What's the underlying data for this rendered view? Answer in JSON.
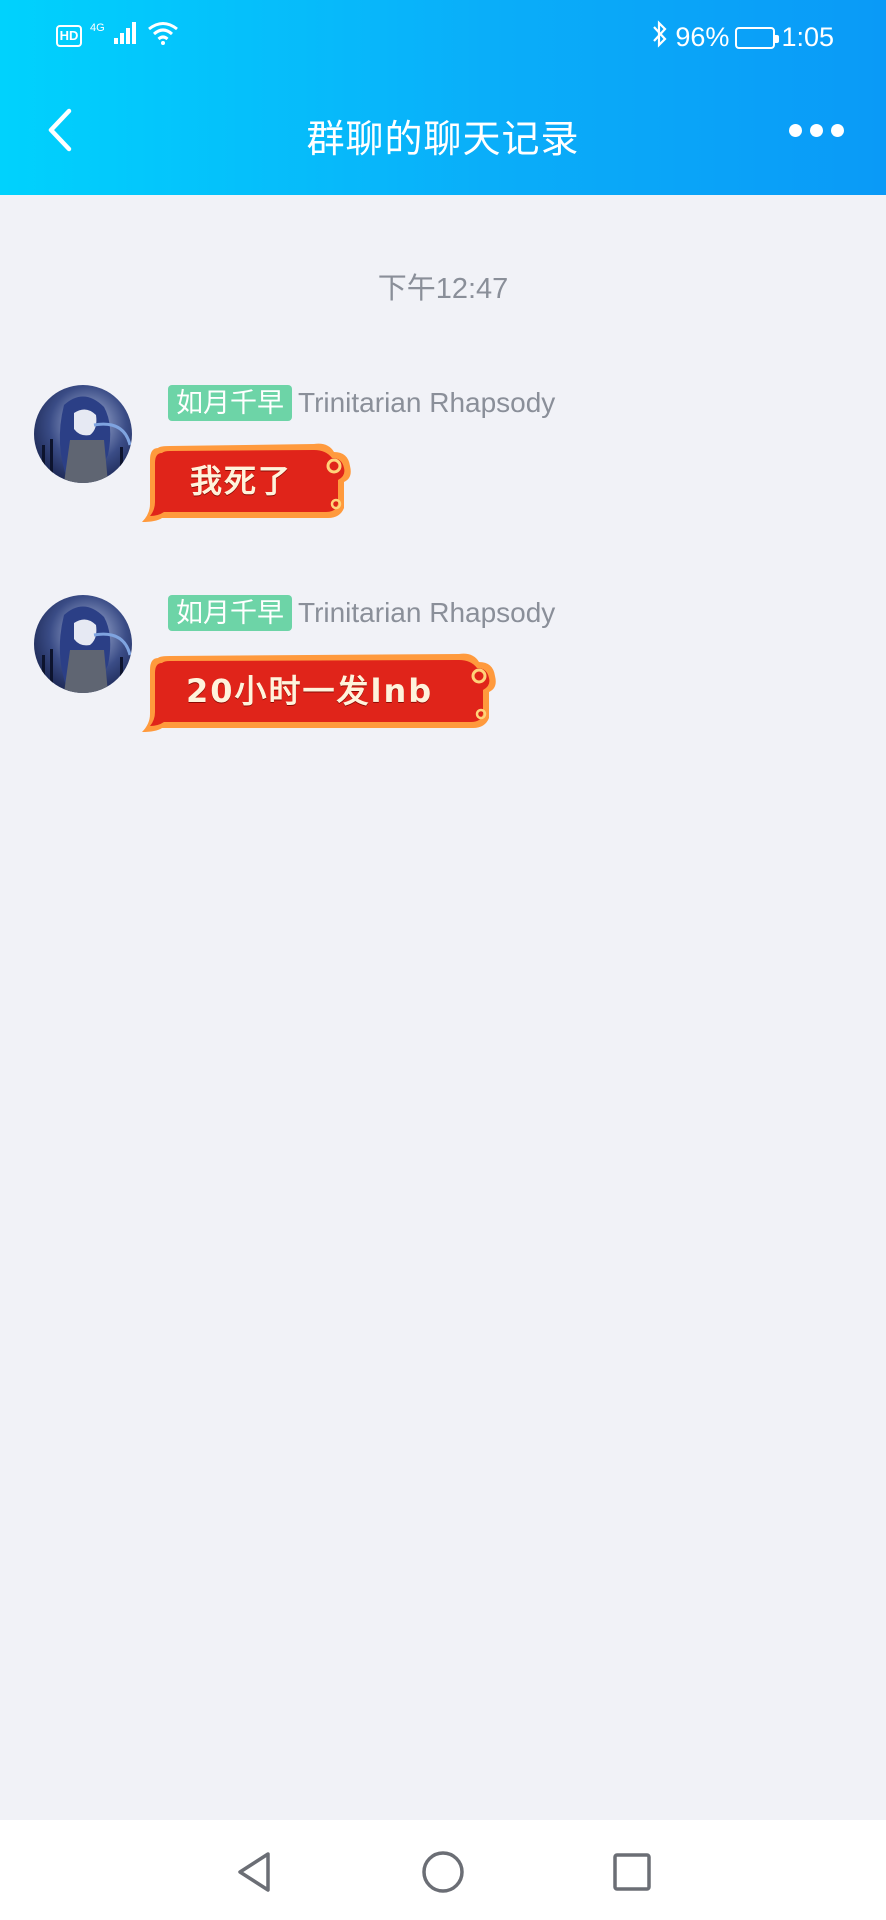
{
  "status_bar": {
    "hd_label": "HD",
    "network_label": "4G",
    "battery_percent": "96%",
    "battery_level": 0.96,
    "time": "1:05"
  },
  "header": {
    "title": "群聊的聊天记录",
    "back_icon": "back-arrow-icon",
    "more_icon": "more-dots-icon"
  },
  "chat": {
    "timestamp": "下午12:47",
    "messages": [
      {
        "tag": "如月千早",
        "sender": "Trinitarian Rhapsody",
        "text": "我死了"
      },
      {
        "tag": "如月千早",
        "sender": "Trinitarian Rhapsody",
        "text": "20小时一发lnb"
      }
    ]
  },
  "bottom_nav": {
    "back_icon": "triangle-back-icon",
    "home_icon": "circle-home-icon",
    "recents_icon": "square-recents-icon"
  },
  "colors": {
    "header_start": "#00d2fd",
    "header_end": "#0a9af7",
    "background": "#f1f2f7",
    "tag_green": "#6dd4a7",
    "bubble_red": "#e0241a",
    "bubble_border": "#ff9a3d"
  }
}
